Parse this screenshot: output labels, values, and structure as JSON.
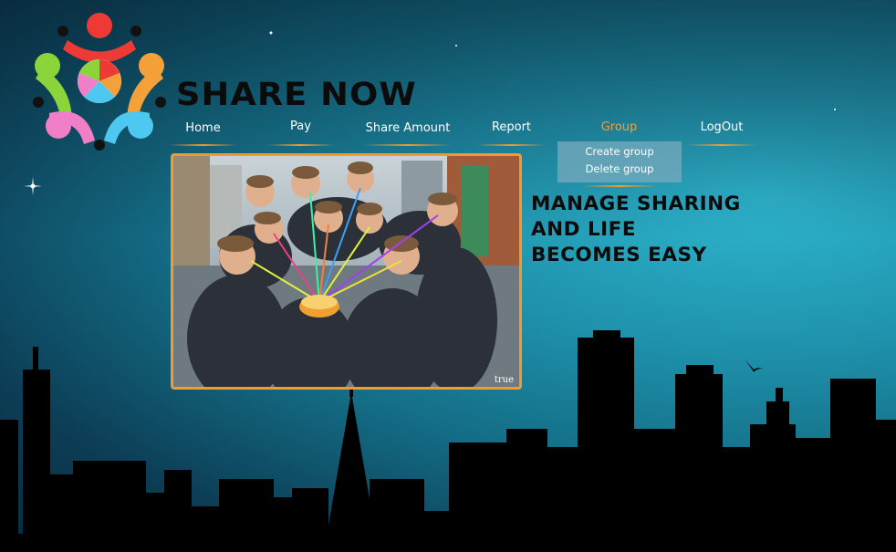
{
  "brand": {
    "title": "SHARE NOW"
  },
  "nav": {
    "items": [
      {
        "label": "Home"
      },
      {
        "label": "Pay"
      },
      {
        "label": "Share Amount"
      },
      {
        "label": "Report"
      },
      {
        "label": "Group"
      },
      {
        "label": "LogOut"
      }
    ],
    "active_label": "Group"
  },
  "group_menu": {
    "items": [
      {
        "label": "Create group"
      },
      {
        "label": "Delete group"
      }
    ]
  },
  "hero": {
    "watermark": "true",
    "tagline": [
      "MANAGE SHARING",
      "AND LIFE",
      "BECOMES EASY"
    ]
  },
  "colors": {
    "accent": "#f39a2e",
    "active_nav": "#f0a040",
    "text": "#ffffff",
    "tagline": "#0b0b0b"
  },
  "icons": {
    "logo": "people-circle-logo-icon"
  }
}
